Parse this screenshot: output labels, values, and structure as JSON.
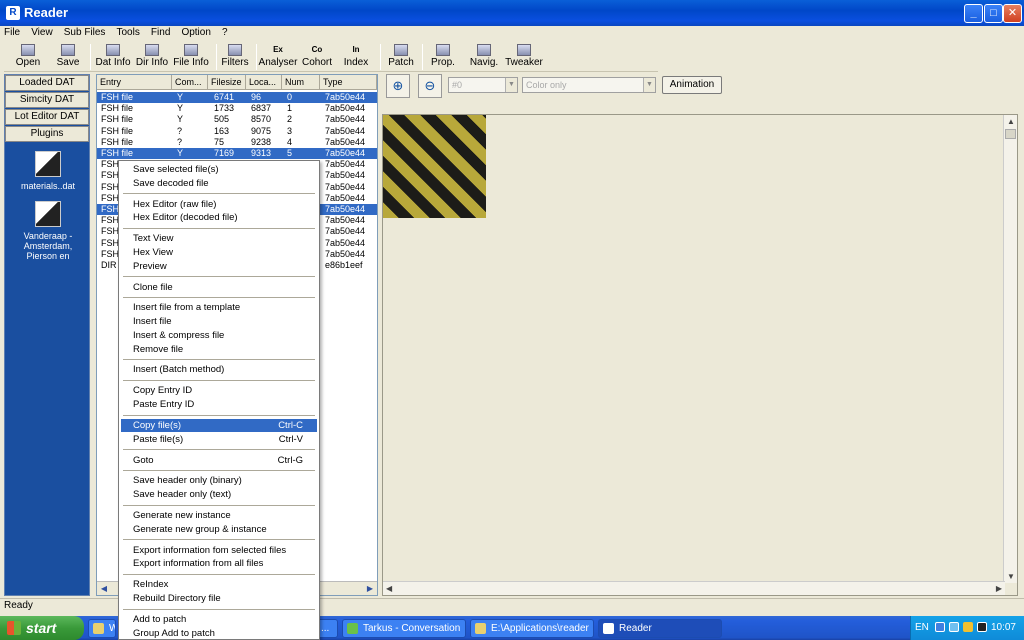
{
  "window": {
    "title": "Reader"
  },
  "menubar": [
    "File",
    "View",
    "Sub Files",
    "Tools",
    "Find",
    "Option",
    "?"
  ],
  "toolbar": {
    "buttons": [
      "Open",
      "Save",
      "Dat Info",
      "Dir Info",
      "File Info",
      "Filters",
      "Analyser",
      "Cohort",
      "Index",
      "Patch",
      "Prop.",
      "Navig.",
      "Tweaker"
    ],
    "icon_labels": {
      "analyser": "Ex",
      "cohort": "Co",
      "index": "In"
    }
  },
  "left_panel": {
    "buttons": [
      "Loaded DAT",
      "Simcity DAT",
      "Lot Editor DAT",
      "Plugins"
    ],
    "plugins": [
      "materials..dat",
      "Vanderaap - Amsterdam, Pierson en"
    ]
  },
  "file_list": {
    "columns": [
      "Entry",
      "Com...",
      "Filesize",
      "Loca...",
      "Num",
      "Type"
    ],
    "rows": [
      {
        "entry": "FSH file",
        "com": "Y",
        "filesize": "6741",
        "loca": "96",
        "num": "0",
        "type": "7ab50e44",
        "selected": true
      },
      {
        "entry": "FSH file",
        "com": "Y",
        "filesize": "1733",
        "loca": "6837",
        "num": "1",
        "type": "7ab50e44",
        "selected": false
      },
      {
        "entry": "FSH file",
        "com": "Y",
        "filesize": "505",
        "loca": "8570",
        "num": "2",
        "type": "7ab50e44",
        "selected": false
      },
      {
        "entry": "FSH file",
        "com": "?",
        "filesize": "163",
        "loca": "9075",
        "num": "3",
        "type": "7ab50e44",
        "selected": false
      },
      {
        "entry": "FSH file",
        "com": "?",
        "filesize": "75",
        "loca": "9238",
        "num": "4",
        "type": "7ab50e44",
        "selected": false
      },
      {
        "entry": "FSH file",
        "com": "Y",
        "filesize": "7169",
        "loca": "9313",
        "num": "5",
        "type": "7ab50e44",
        "selected": true
      },
      {
        "entry": "FSH",
        "com": "",
        "filesize": "",
        "loca": "",
        "num": "",
        "type": "7ab50e44",
        "selected": false
      },
      {
        "entry": "FSH",
        "com": "",
        "filesize": "",
        "loca": "",
        "num": "",
        "type": "7ab50e44",
        "selected": false
      },
      {
        "entry": "FSH",
        "com": "",
        "filesize": "",
        "loca": "",
        "num": "",
        "type": "7ab50e44",
        "selected": false
      },
      {
        "entry": "FSH",
        "com": "",
        "filesize": "",
        "loca": "",
        "num": "",
        "type": "7ab50e44",
        "selected": false
      },
      {
        "entry": "FSH",
        "com": "",
        "filesize": "",
        "loca": "",
        "num": "",
        "type": "7ab50e44",
        "selected": true
      },
      {
        "entry": "FSH",
        "com": "",
        "filesize": "",
        "loca": "",
        "num": "",
        "type": "7ab50e44",
        "selected": false
      },
      {
        "entry": "FSH",
        "com": "",
        "filesize": "",
        "loca": "",
        "num": "",
        "type": "7ab50e44",
        "selected": false
      },
      {
        "entry": "FSH",
        "com": "",
        "filesize": "",
        "loca": "",
        "num": "",
        "type": "7ab50e44",
        "selected": false
      },
      {
        "entry": "FSH",
        "com": "",
        "filesize": "",
        "loca": "",
        "num": "",
        "type": "7ab50e44",
        "selected": false
      },
      {
        "entry": "DIR",
        "com": "",
        "filesize": "",
        "loca": "",
        "num": "",
        "type": "e86b1eef",
        "selected": false
      }
    ]
  },
  "preview_tools": {
    "frame_combo": "#0",
    "color_combo": "Color only",
    "animation_button": "Animation"
  },
  "context_menu": {
    "items": [
      {
        "label": "Save selected file(s)",
        "shortcut": ""
      },
      {
        "label": "Save decoded file",
        "shortcut": ""
      },
      {
        "sep": true
      },
      {
        "label": "Hex Editor (raw file)",
        "shortcut": ""
      },
      {
        "label": "Hex Editor (decoded file)",
        "shortcut": ""
      },
      {
        "sep": true
      },
      {
        "label": "Text View",
        "shortcut": ""
      },
      {
        "label": "Hex View",
        "shortcut": ""
      },
      {
        "label": "Preview",
        "shortcut": ""
      },
      {
        "sep": true
      },
      {
        "label": "Clone file",
        "shortcut": ""
      },
      {
        "sep": true
      },
      {
        "label": "Insert file from a template",
        "shortcut": ""
      },
      {
        "label": "Insert file",
        "shortcut": ""
      },
      {
        "label": "Insert & compress file",
        "shortcut": ""
      },
      {
        "label": "Remove file",
        "shortcut": ""
      },
      {
        "sep": true
      },
      {
        "label": "Insert (Batch method)",
        "shortcut": ""
      },
      {
        "sep": true
      },
      {
        "label": "Copy Entry ID",
        "shortcut": ""
      },
      {
        "label": "Paste Entry ID",
        "shortcut": ""
      },
      {
        "sep": true
      },
      {
        "label": "Copy file(s)",
        "shortcut": "Ctrl-C",
        "highlighted": true
      },
      {
        "label": "Paste file(s)",
        "shortcut": "Ctrl-V"
      },
      {
        "sep": true
      },
      {
        "label": "Goto",
        "shortcut": "Ctrl-G"
      },
      {
        "sep": true
      },
      {
        "label": "Save header only (binary)",
        "shortcut": ""
      },
      {
        "label": "Save header only (text)",
        "shortcut": ""
      },
      {
        "sep": true
      },
      {
        "label": "Generate new instance",
        "shortcut": ""
      },
      {
        "label": "Generate new group & instance",
        "shortcut": ""
      },
      {
        "sep": true
      },
      {
        "label": "Export information fom selected files",
        "shortcut": ""
      },
      {
        "label": "Export information from all files",
        "shortcut": ""
      },
      {
        "sep": true
      },
      {
        "label": "ReIndex",
        "shortcut": ""
      },
      {
        "label": "Rebuild Directory file",
        "shortcut": ""
      },
      {
        "sep": true
      },
      {
        "label": "Add to patch",
        "shortcut": ""
      },
      {
        "label": "Group Add to patch",
        "shortcut": ""
      }
    ]
  },
  "status": {
    "text": "Ready"
  },
  "taskbar": {
    "start_label": "start",
    "tasks": [
      {
        "label": "W",
        "active": false
      },
      {
        "label": "...",
        "active": false
      },
      {
        "label": "Tarkus - Conversation",
        "active": false
      },
      {
        "label": "E:\\Applications\\reader",
        "active": false
      },
      {
        "label": "Reader",
        "active": true
      }
    ],
    "language": "EN",
    "clock": "10:07"
  },
  "colors": {
    "selection": "#316ac5",
    "left_panel": "#1a4fa0",
    "titlebar": "#0047c8"
  }
}
